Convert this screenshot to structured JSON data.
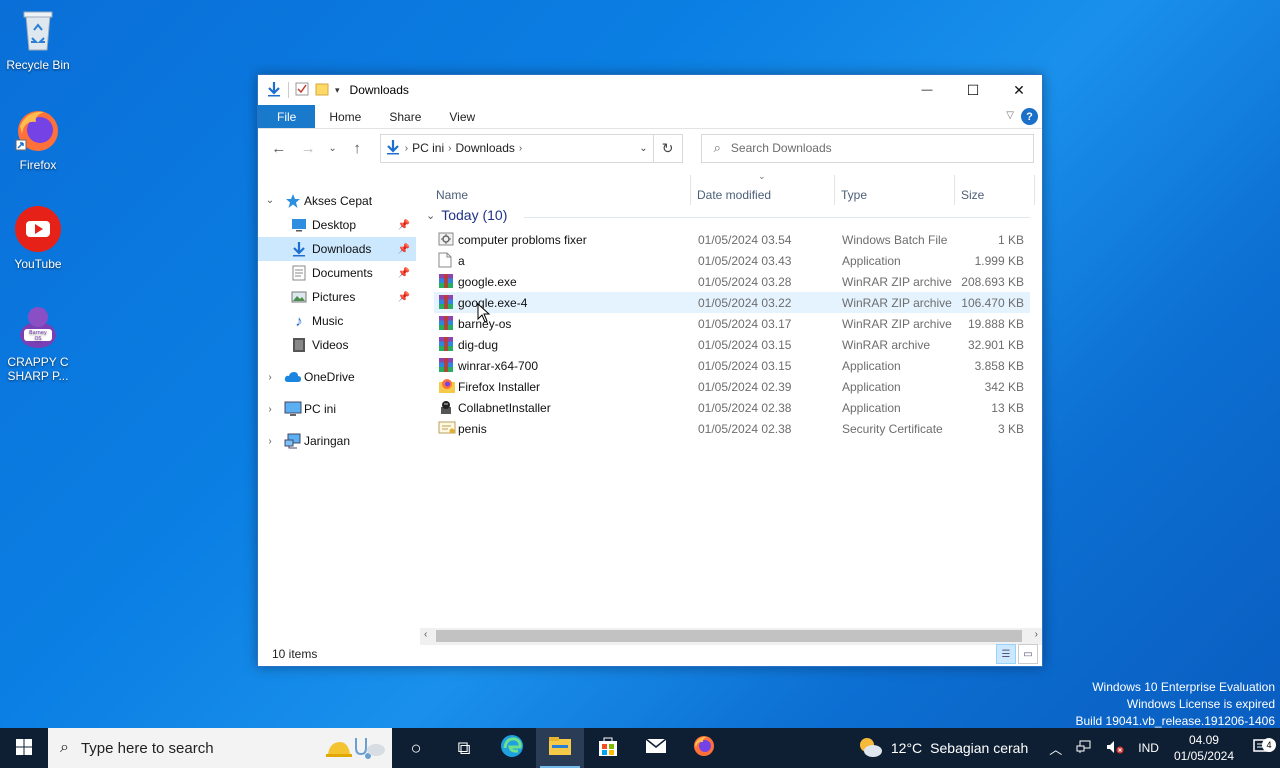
{
  "desktop": {
    "icons": [
      {
        "label": "Recycle Bin",
        "icon": "recycle-bin-icon"
      },
      {
        "label": "Firefox",
        "icon": "firefox-icon"
      },
      {
        "label": "YouTube",
        "icon": "youtube-icon"
      },
      {
        "label": "CRAPPY C SHARP P...",
        "icon": "barney-os-icon"
      }
    ]
  },
  "window": {
    "title": "Downloads",
    "controls": {
      "minimize": "—",
      "maximize": "☐",
      "close": "✕"
    },
    "ribbon": {
      "tabs": [
        "File",
        "Home",
        "Share",
        "View"
      ],
      "help": "?"
    },
    "address": {
      "crumbs": [
        "PC ini",
        "Downloads"
      ]
    },
    "search": {
      "placeholder": "Search Downloads"
    },
    "nav": {
      "quick_access": "Akses Cepat",
      "items": [
        {
          "label": "Desktop",
          "icon": "desktop-folder-icon",
          "pinned": true
        },
        {
          "label": "Downloads",
          "icon": "downloads-folder-icon",
          "pinned": true,
          "selected": true
        },
        {
          "label": "Documents",
          "icon": "documents-folder-icon",
          "pinned": true
        },
        {
          "label": "Pictures",
          "icon": "pictures-folder-icon",
          "pinned": true
        },
        {
          "label": "Music",
          "icon": "music-folder-icon",
          "pinned": false
        },
        {
          "label": "Videos",
          "icon": "videos-folder-icon",
          "pinned": false
        }
      ],
      "roots": [
        {
          "label": "OneDrive",
          "icon": "onedrive-icon"
        },
        {
          "label": "PC ini",
          "icon": "pc-icon"
        },
        {
          "label": "Jaringan",
          "icon": "network-icon"
        }
      ]
    },
    "columns": {
      "name": "Name",
      "date": "Date modified",
      "type": "Type",
      "size": "Size"
    },
    "group": {
      "label": "Today (10)"
    },
    "files": [
      {
        "name": "computer probloms fixer",
        "date": "01/05/2024 03.54",
        "type": "Windows Batch File",
        "size": "1 KB",
        "icon": "batch-file-icon"
      },
      {
        "name": "a",
        "date": "01/05/2024 03.43",
        "type": "Application",
        "size": "1.999 KB",
        "icon": "blank-file-icon"
      },
      {
        "name": "google.exe",
        "date": "01/05/2024 03.28",
        "type": "WinRAR ZIP archive",
        "size": "208.693 KB",
        "icon": "winrar-icon"
      },
      {
        "name": "google.exe-4",
        "date": "01/05/2024 03.22",
        "type": "WinRAR ZIP archive",
        "size": "106.470 KB",
        "icon": "winrar-icon"
      },
      {
        "name": "barney-os",
        "date": "01/05/2024 03.17",
        "type": "WinRAR ZIP archive",
        "size": "19.888 KB",
        "icon": "winrar-icon"
      },
      {
        "name": "dig-dug",
        "date": "01/05/2024 03.15",
        "type": "WinRAR archive",
        "size": "32.901 KB",
        "icon": "winrar-icon"
      },
      {
        "name": "winrar-x64-700",
        "date": "01/05/2024 03.15",
        "type": "Application",
        "size": "3.858 KB",
        "icon": "winrar-icon"
      },
      {
        "name": "Firefox Installer",
        "date": "01/05/2024 02.39",
        "type": "Application",
        "size": "342 KB",
        "icon": "firefox-installer-icon"
      },
      {
        "name": "CollabnetInstaller",
        "date": "01/05/2024 02.38",
        "type": "Application",
        "size": "13 KB",
        "icon": "installer-icon"
      },
      {
        "name": "penis",
        "date": "01/05/2024 02.38",
        "type": "Security Certificate",
        "size": "3 KB",
        "icon": "certificate-icon"
      }
    ],
    "status": "10 items"
  },
  "watermark": {
    "line1": "Windows 10 Enterprise Evaluation",
    "line2": "Windows License is expired",
    "line3": "Build 19041.vb_release.191206-1406"
  },
  "taskbar": {
    "search_placeholder": "Type here to search",
    "weather": {
      "temp": "12°C",
      "desc": "Sebagian cerah"
    },
    "lang": "IND",
    "time": "04.09",
    "date": "01/05/2024",
    "notifications": "4"
  },
  "colors": {
    "accent": "#1979ca",
    "selection": "#cce8ff",
    "taskbar": "#0f1f33"
  }
}
